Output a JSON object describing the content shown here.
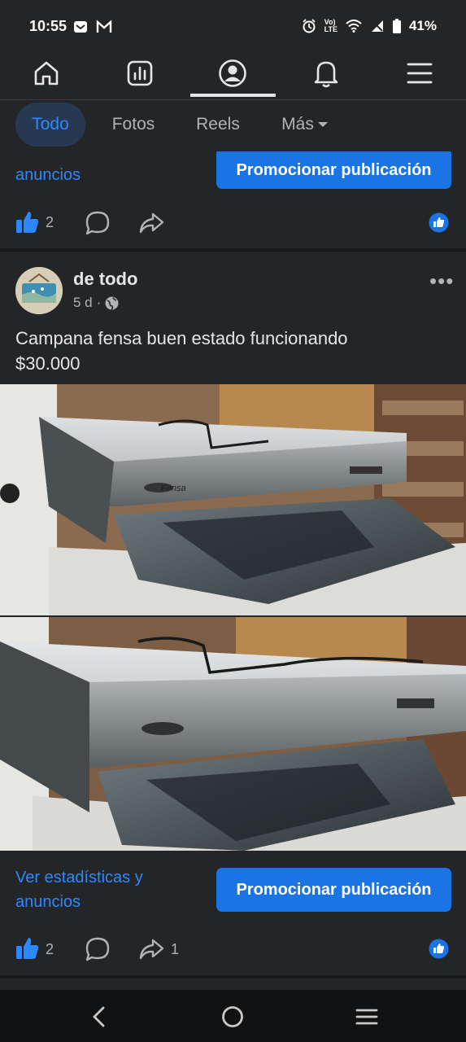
{
  "status_bar": {
    "time": "10:55",
    "battery": "41%",
    "left_icons": [
      "mail-notification-icon",
      "gmail-icon"
    ],
    "right_icons": [
      "alarm-icon",
      "volte-icon",
      "wifi-icon",
      "signal-icon",
      "battery-icon"
    ],
    "volte_label": "Vo)\nLTE"
  },
  "nav": {
    "items": [
      {
        "name": "home-icon"
      },
      {
        "name": "dashboard-icon"
      },
      {
        "name": "profile-icon",
        "active": true
      },
      {
        "name": "notifications-icon"
      },
      {
        "name": "menu-icon"
      }
    ]
  },
  "filters": {
    "todo": "Todo",
    "fotos": "Fotos",
    "reels": "Reels",
    "mas": "Más"
  },
  "prev_post": {
    "link_partial": "anuncios",
    "promote_label": "Promocionar publicación",
    "like_count": "2"
  },
  "post": {
    "author": "de todo",
    "time": "5 d",
    "text": "Campana  fensa buen estado funcionando\n$30.000",
    "brand_on_product": "Fensa",
    "stats_link": "Ver estadísticas y\nanuncios",
    "promote_label": "Promocionar publicación",
    "like_count": "2",
    "share_count": "1"
  },
  "colors": {
    "background": "#242526",
    "accent": "#2d88ff",
    "button": "#1b74e4",
    "text": "#e4e6eb",
    "muted": "#b0b3b8"
  }
}
